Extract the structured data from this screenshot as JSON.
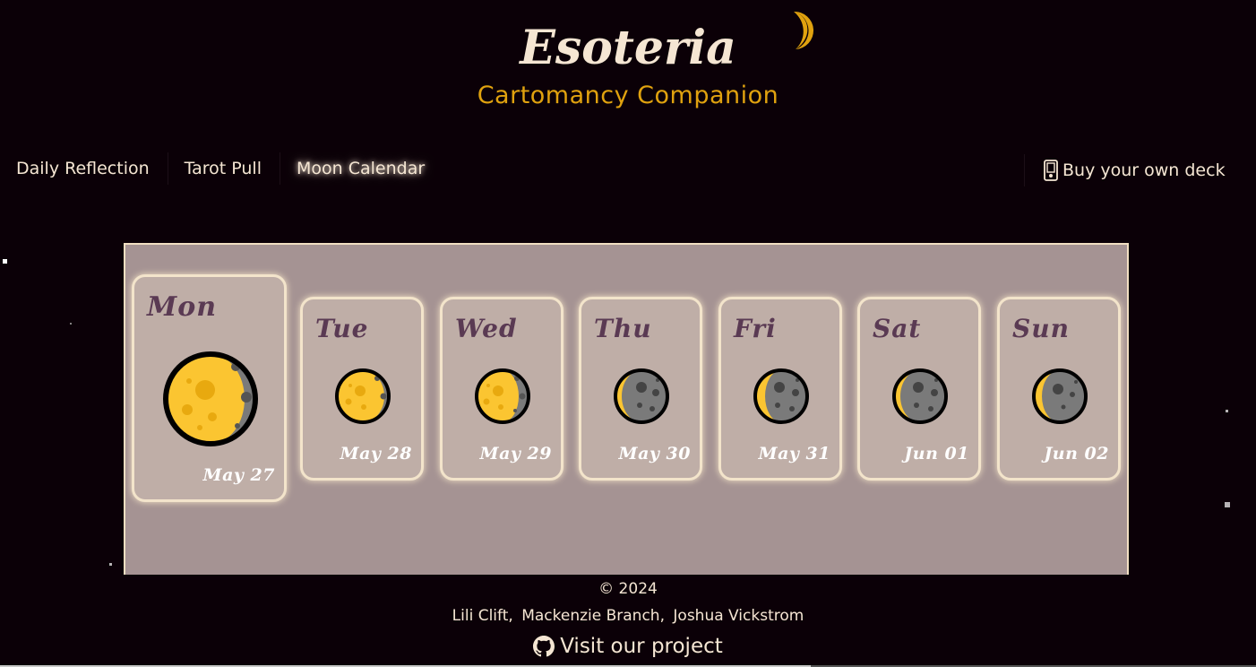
{
  "header": {
    "title": "Esoteria",
    "subtitle": "Cartomancy Companion",
    "logo_icon": "crescent-moon-icon"
  },
  "nav": {
    "items": [
      {
        "label": "Daily Reflection",
        "active": false
      },
      {
        "label": "Tarot Pull",
        "active": false
      },
      {
        "label": "Moon Calendar",
        "active": true
      }
    ],
    "buy_label": "Buy your own deck",
    "buy_icon": "card-icon"
  },
  "calendar": {
    "days": [
      {
        "day": "Mon",
        "date": "May 27",
        "phase": "waning-gibbous",
        "today": true
      },
      {
        "day": "Tue",
        "date": "May 28",
        "phase": "waning-gibbous",
        "today": false
      },
      {
        "day": "Wed",
        "date": "May 29",
        "phase": "waning-gibbous",
        "today": false
      },
      {
        "day": "Thu",
        "date": "May 30",
        "phase": "last-quarter",
        "today": false
      },
      {
        "day": "Fri",
        "date": "May 31",
        "phase": "waning-crescent",
        "today": false
      },
      {
        "day": "Sat",
        "date": "Jun 01",
        "phase": "waning-crescent",
        "today": false
      },
      {
        "day": "Sun",
        "date": "Jun 02",
        "phase": "waning-crescent",
        "today": false
      }
    ]
  },
  "footer": {
    "copyright": "© 2024",
    "authors": [
      "Lili Clift",
      "Mackenzie Branch",
      "Joshua Vickstrom"
    ],
    "project_label": "Visit our project",
    "project_icon": "github-icon"
  },
  "colors": {
    "background": "#0b0007",
    "accent": "#e0a20f",
    "cream": "#f5e6d3",
    "panel": "#a59393",
    "card": "#bfaea7",
    "moon_lit": "#fbc531",
    "moon_dark": "#7a7a7a"
  }
}
